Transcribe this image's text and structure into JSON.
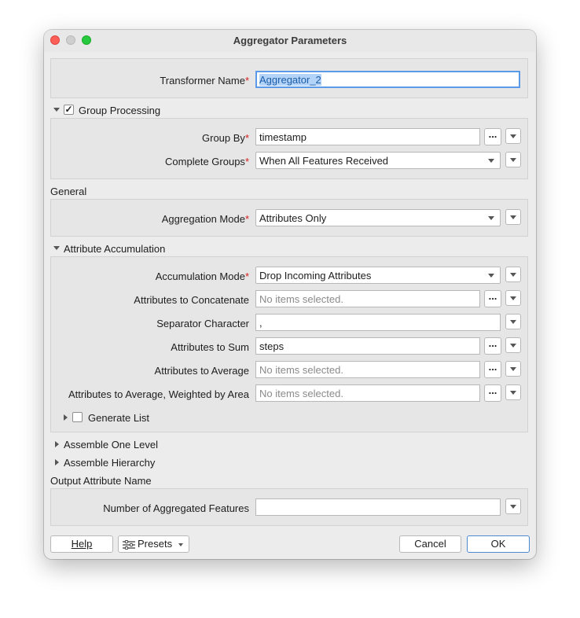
{
  "window": {
    "title": "Aggregator Parameters"
  },
  "transformer": {
    "label": "Transformer Name",
    "value": "Aggregator_2"
  },
  "group_processing": {
    "label": "Group Processing",
    "checked": "✓",
    "group_by": {
      "label": "Group By",
      "value": "timestamp"
    },
    "complete_groups": {
      "label": "Complete Groups",
      "value": "When All Features Received"
    }
  },
  "general": {
    "label": "General",
    "aggregation_mode": {
      "label": "Aggregation Mode",
      "value": "Attributes Only"
    }
  },
  "attribute_accumulation": {
    "label": "Attribute Accumulation",
    "accumulation_mode": {
      "label": "Accumulation Mode",
      "value": "Drop Incoming Attributes"
    },
    "concatenate": {
      "label": "Attributes to Concatenate",
      "placeholder": "No items selected."
    },
    "separator": {
      "label": "Separator Character",
      "value": ","
    },
    "sum": {
      "label": "Attributes to Sum",
      "value": "steps"
    },
    "average": {
      "label": "Attributes to Average",
      "placeholder": "No items selected."
    },
    "weighted": {
      "label": "Attributes to Average, Weighted by Area",
      "placeholder": "No items selected."
    },
    "generate_list": {
      "label": "Generate List"
    }
  },
  "assemble_one_level": {
    "label": "Assemble One Level"
  },
  "assemble_hierarchy": {
    "label": "Assemble Hierarchy"
  },
  "output": {
    "label": "Output Attribute Name",
    "num_features": {
      "label": "Number of Aggregated Features",
      "value": ""
    }
  },
  "buttons": {
    "ellipsis": "...",
    "required_mark": "*",
    "help": "Help",
    "presets": "Presets",
    "cancel": "Cancel",
    "ok": "OK"
  }
}
